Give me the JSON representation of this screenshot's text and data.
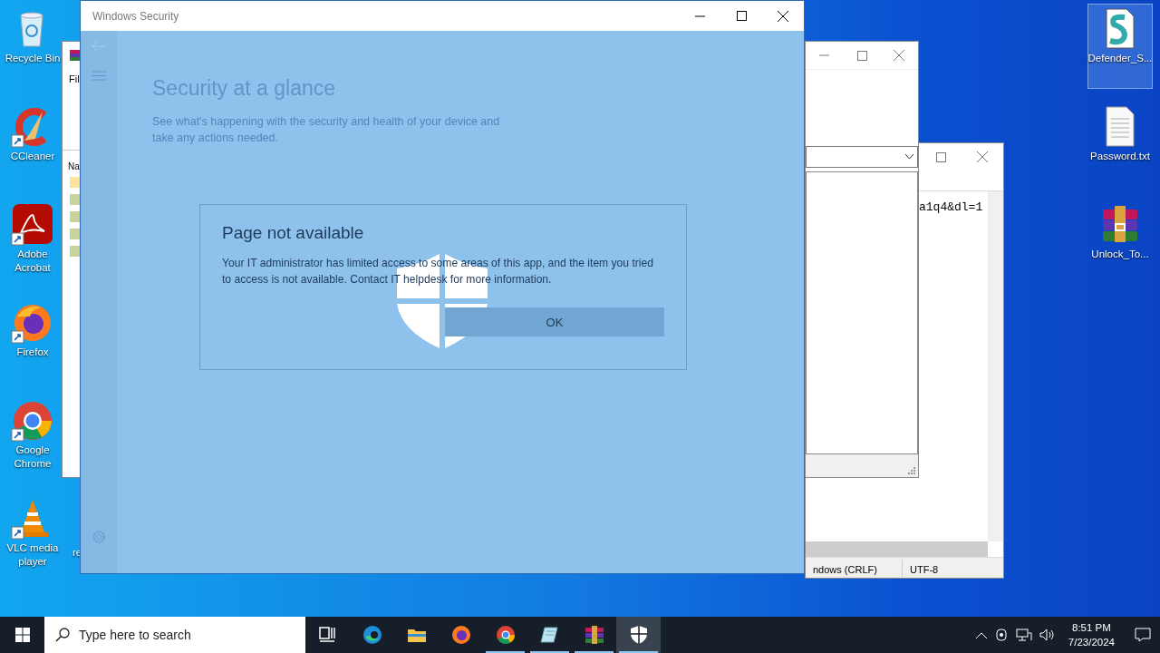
{
  "desktop_icons_left": [
    {
      "label": "Recycle Bin",
      "kind": "recycle",
      "shortcut": false
    },
    {
      "label": "CCleaner",
      "kind": "ccleaner",
      "shortcut": true
    },
    {
      "label": "Adobe Acrobat",
      "kind": "acrobat",
      "shortcut": true
    },
    {
      "label": "Firefox",
      "kind": "firefox",
      "shortcut": true
    },
    {
      "label": "Google Chrome",
      "kind": "chrome",
      "shortcut": true
    },
    {
      "label": "VLC media player",
      "kind": "vlc",
      "shortcut": true
    }
  ],
  "covered_icon_label": "re",
  "desktop_icons_right": [
    {
      "label": "Defender_S...",
      "kind": "script",
      "selected": true
    },
    {
      "label": "Password.txt",
      "kind": "text",
      "selected": false
    },
    {
      "label": "Unlock_To...",
      "kind": "archive",
      "selected": false
    }
  ],
  "explorer_window": {
    "menu_text": "Fil",
    "column_header": "Na"
  },
  "notepad_window": {
    "text": "a1q4&dl=1",
    "status": [
      "ndows (CRLF)",
      "UTF-8"
    ]
  },
  "windows_security": {
    "title": "Windows Security",
    "heading": "Security at a glance",
    "subtitle": "See what's happening with the security and health of your device and take any actions needed.",
    "dialog": {
      "title": "Page not available",
      "message": "Your IT administrator has limited access to some areas of this app, and the item you tried to access is not available. Contact IT helpdesk for more information.",
      "button": "OK"
    }
  },
  "taskbar": {
    "search_placeholder": "Type here to search",
    "apps": [
      {
        "kind": "taskview",
        "running": false,
        "selected": false
      },
      {
        "kind": "edge",
        "running": false,
        "selected": false
      },
      {
        "kind": "explorer",
        "running": false,
        "selected": false
      },
      {
        "kind": "firefox",
        "running": false,
        "selected": false
      },
      {
        "kind": "chrome",
        "running": true,
        "selected": false
      },
      {
        "kind": "notepad",
        "running": true,
        "selected": false
      },
      {
        "kind": "winrar",
        "running": true,
        "selected": false
      },
      {
        "kind": "security",
        "running": true,
        "selected": true
      }
    ],
    "time": "8:51 PM",
    "date": "7/23/2024"
  }
}
